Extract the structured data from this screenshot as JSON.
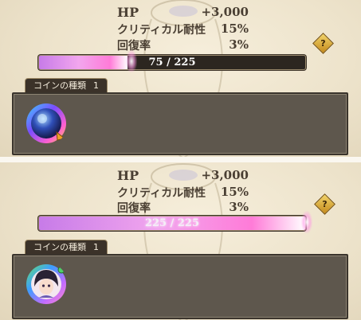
{
  "panels": [
    {
      "stats": [
        {
          "label": "HP",
          "value": "+3,000"
        },
        {
          "label": "クリティカル耐性",
          "value": "15%"
        },
        {
          "label": "回復率",
          "value": "3%"
        }
      ],
      "help_label": "?",
      "progress": {
        "current": 75,
        "max": 225,
        "fraction": 0.333,
        "text": "75 / 225"
      },
      "coin_section": {
        "label": "コインの種類",
        "count": "1"
      },
      "coins": [
        {
          "icon": "blue-crystal-orb-coin-icon"
        }
      ]
    },
    {
      "stats": [
        {
          "label": "HP",
          "value": "+3,000"
        },
        {
          "label": "クリティカル耐性",
          "value": "15%"
        },
        {
          "label": "回復率",
          "value": "3%"
        }
      ],
      "help_label": "?",
      "progress": {
        "current": 225,
        "max": 225,
        "fraction": 1.0,
        "text": "225 / 225"
      },
      "coin_section": {
        "label": "コインの種類",
        "count": "1"
      },
      "coins": [
        {
          "icon": "character-portrait-coin-icon"
        }
      ]
    }
  ],
  "colors": {
    "bar_fill": "#f2a6ee",
    "bar_track": "#2c2620",
    "coin_box": "#5e574d",
    "text_dark": "#4a3f33"
  }
}
